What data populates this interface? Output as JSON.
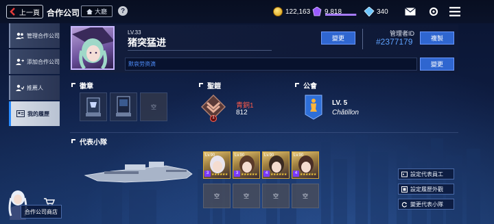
{
  "topbar": {
    "back_label": "上一頁",
    "title": "合作公司",
    "lobby_label": "大廳",
    "help": "?",
    "gold": "122,163",
    "purple": "9,818",
    "purple_fill": 0.98,
    "gem": "340"
  },
  "sidebar": {
    "items": [
      {
        "label": "管理合作公司"
      },
      {
        "label": "添加合作公司"
      },
      {
        "label": "推薦人"
      },
      {
        "label": "我的履歷"
      }
    ],
    "shop_label": "合作公司商店"
  },
  "profile": {
    "level": "LV.33",
    "name": "猪突猛进",
    "change_name": "變更",
    "manager_label": "管理者ID",
    "manager_id": "#2377179",
    "copy_label": "複製",
    "motto": "默哀劳资滴",
    "change_motto": "變更"
  },
  "sections": {
    "badge": "徽章",
    "armor": "聖鎧",
    "guild": "公會",
    "team": "代表小隊"
  },
  "badges": [
    {
      "label": ""
    },
    {
      "label": ""
    },
    {
      "label": "空"
    }
  ],
  "armor": {
    "name": "青銅1",
    "score": "812",
    "rank_num": "1"
  },
  "guild": {
    "level": "LV. 5",
    "name": "Châtillon"
  },
  "team": {
    "heroes": [
      {
        "level": "Lv.90",
        "rank": "3",
        "stars": "★★★★★★"
      },
      {
        "level": "Lv.90",
        "rank": "3",
        "stars": "★★★★★★"
      },
      {
        "level": "Lv.90",
        "rank": "4",
        "stars": "★★★★★★"
      },
      {
        "level": "Lv.90",
        "rank": "4",
        "stars": "★★★★★★"
      }
    ],
    "empty_slots": [
      "空",
      "空",
      "空",
      "空"
    ]
  },
  "right_buttons": [
    {
      "label": "設定代表員工"
    },
    {
      "label": "設定履歷外觀"
    },
    {
      "label": "變更代表小隊"
    }
  ],
  "colors": {
    "accent_blue": "#2f66d0",
    "id_blue": "#5fa3ff",
    "armor_red": "#ff5a4a",
    "active_tab_border": "#2a8cff"
  }
}
